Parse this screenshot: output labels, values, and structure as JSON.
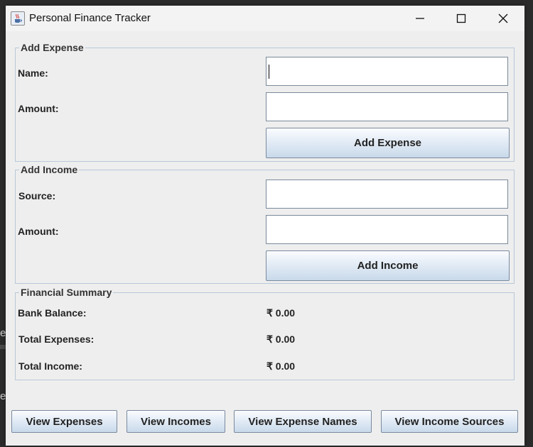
{
  "window": {
    "title": "Personal Finance Tracker"
  },
  "add_expense": {
    "section_title": "Add Expense",
    "name_label": "Name:",
    "name_value": "",
    "amount_label": "Amount:",
    "amount_value": "",
    "button_label": "Add Expense"
  },
  "add_income": {
    "section_title": "Add Income",
    "source_label": "Source:",
    "source_value": "",
    "amount_label": "Amount:",
    "amount_value": "",
    "button_label": "Add Income"
  },
  "summary": {
    "section_title": "Financial Summary",
    "bank_balance_label": "Bank Balance:",
    "bank_balance_value": "₹ 0.00",
    "total_expenses_label": "Total Expenses:",
    "total_expenses_value": "₹ 0.00",
    "total_income_label": "Total Income:",
    "total_income_value": "₹ 0.00"
  },
  "bottom_buttons": {
    "view_expenses": "View Expenses",
    "view_incomes": "View Incomes",
    "view_expense_names": "View Expense Names",
    "view_income_sources": "View Income Sources"
  },
  "icons": {
    "app": "java-coffee-icon",
    "minimize": "minimize-icon",
    "maximize": "maximize-icon",
    "close": "close-icon"
  }
}
